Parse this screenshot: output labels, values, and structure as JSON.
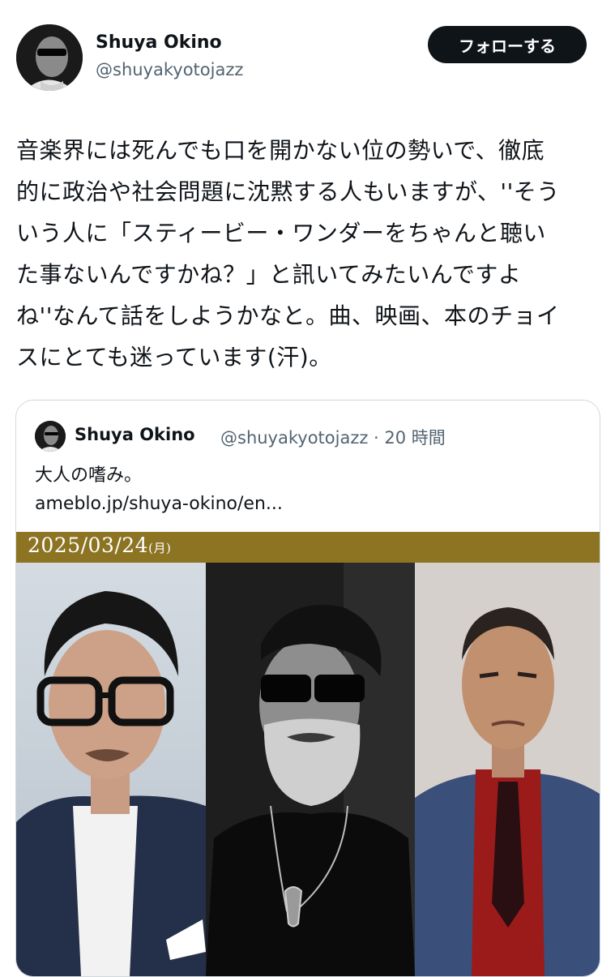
{
  "author": {
    "name": "Shuya Okino",
    "handle": "@shuyakyotojazz",
    "follow_label": "フォローする"
  },
  "tweet": {
    "text": "音楽界には死んでも口を開かない位の勢いで、徹底\n的に政治や社会問題に沈黙する人もいますが、''そう\nいう人に「スティービー・ワンダーをちゃんと聴い\nた事ないんですかね？」と訊いてみたいんですよ\nね''なんて話をしようかなと。曲、映画、本のチョイ\nスにとても迷っています(汗)。"
  },
  "quoted": {
    "name": "Shuya Okino",
    "handle_time": "@shuyakyotojazz · 20 時間",
    "text": "大人の嗜み。",
    "link": "ameblo.jp/shuya-okino/en...",
    "banner_date": "2025/03/24",
    "banner_day": "(月)"
  },
  "colors": {
    "banner": "#8c7423",
    "follow_bg": "#0f1419",
    "secondary_text": "#536471"
  }
}
